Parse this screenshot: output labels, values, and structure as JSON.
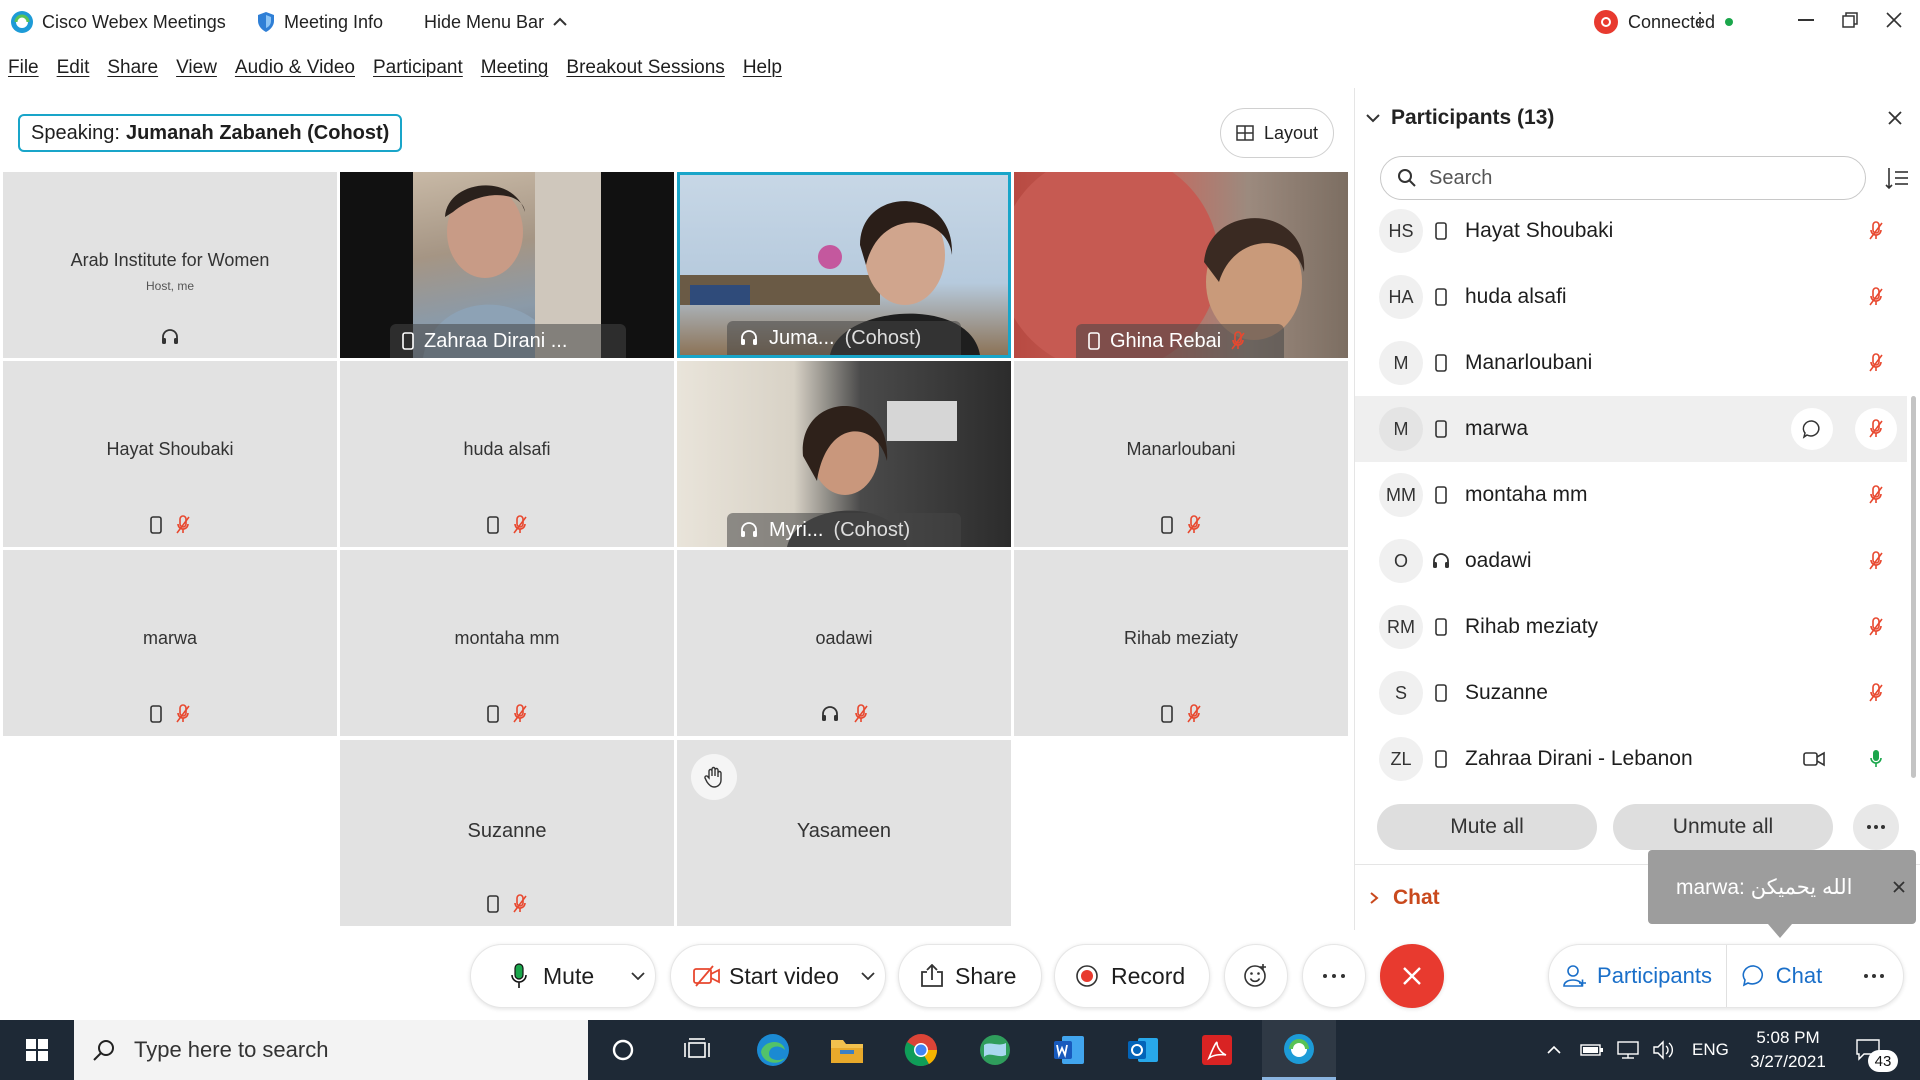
{
  "titlebar": {
    "app_name": "Cisco Webex Meetings",
    "meeting_info": "Meeting Info",
    "hide_menu": "Hide Menu Bar",
    "status": "Connected"
  },
  "menu": [
    "File",
    "Edit",
    "Share",
    "View",
    "Audio & Video",
    "Participant",
    "Meeting",
    "Breakout Sessions",
    "Help"
  ],
  "speaking": {
    "prefix": "Speaking:",
    "name": "Jumanah Zabaneh (Cohost)"
  },
  "layout_label": "Layout",
  "tiles": {
    "host_name": "Arab Institute for Women",
    "host_sub": "Host, me",
    "zahraa_label": "Zahraa Dirani ...",
    "jumanah_label": "Juma...",
    "jumanah_cohost": "(Cohost)",
    "ghina_label": "Ghina Rebai",
    "hayat": "Hayat Shoubaki",
    "huda": "huda alsafi",
    "myri_label": "Myri...",
    "myri_cohost": "(Cohost)",
    "manar": "Manarloubani",
    "marwa": "marwa",
    "montaha": "montaha mm",
    "oadawi": "oadawi",
    "rihab": "Rihab meziaty",
    "suzanne": "Suzanne",
    "yasameen": "Yasameen"
  },
  "panel": {
    "title": "Participants (13)",
    "search_placeholder": "Search",
    "participants": [
      {
        "initials": "HS",
        "name": "Hayat Shoubaki",
        "device": "phone"
      },
      {
        "initials": "HA",
        "name": "huda alsafi",
        "device": "phone"
      },
      {
        "initials": "M",
        "name": "Manarloubani",
        "device": "phone"
      },
      {
        "initials": "M",
        "name": "marwa",
        "device": "phone"
      },
      {
        "initials": "MM",
        "name": "montaha mm",
        "device": "phone"
      },
      {
        "initials": "O",
        "name": "oadawi",
        "device": "headset"
      },
      {
        "initials": "RM",
        "name": "Rihab meziaty",
        "device": "phone"
      },
      {
        "initials": "S",
        "name": "Suzanne",
        "device": "phone"
      },
      {
        "initials": "ZL",
        "name": "Zahraa Dirani - Lebanon",
        "device": "phone"
      }
    ],
    "mute_all": "Mute all",
    "unmute_all": "Unmute all",
    "chat_label": "Chat"
  },
  "toast": {
    "text": "marwa: الله يحميكن"
  },
  "controls": {
    "mute": "Mute",
    "start_video": "Start video",
    "share": "Share",
    "record": "Record",
    "participants": "Participants",
    "chat": "Chat"
  },
  "taskbar": {
    "search_placeholder": "Type here to search",
    "lang": "ENG",
    "time": "5:08 PM",
    "date": "3/27/2021",
    "notifications": "43"
  },
  "colors": {
    "accent": "#19a5c9",
    "end_call": "#e83a2f",
    "mic_muted": "#e8482f",
    "mic_active": "#1aa64b",
    "chat_label": "#c9491d",
    "link_blue": "#1a6fc9"
  }
}
